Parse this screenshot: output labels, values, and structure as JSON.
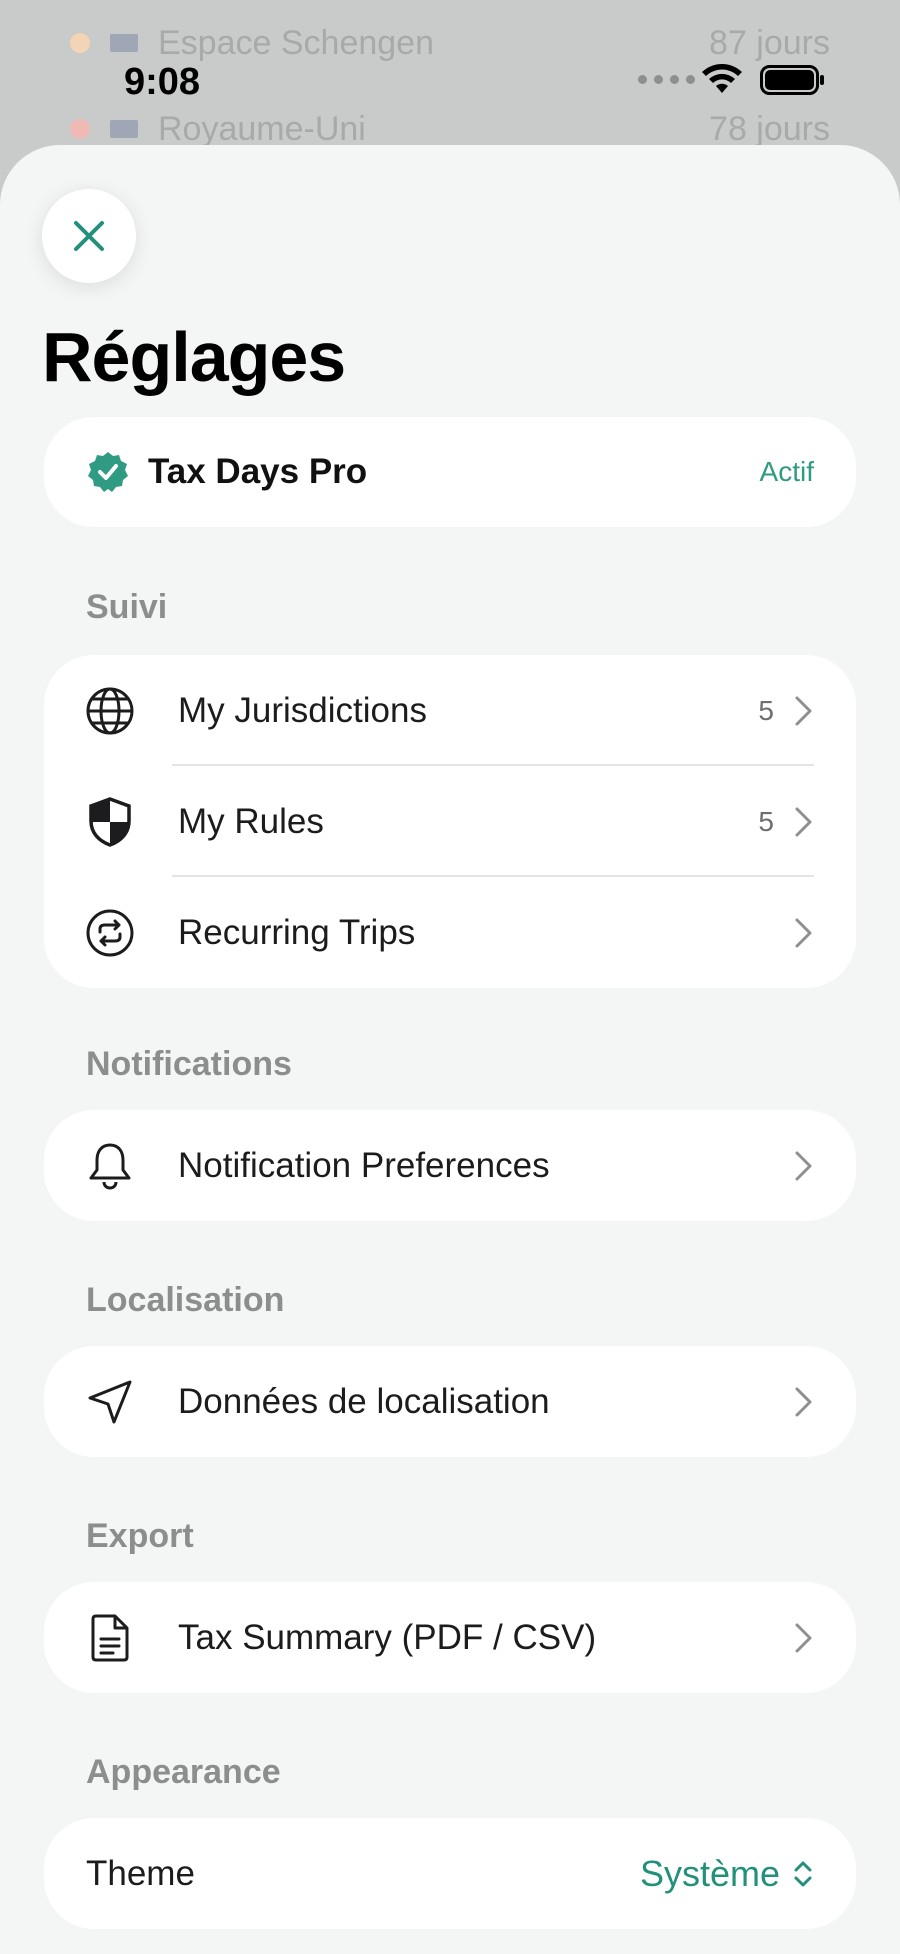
{
  "background": {
    "rows": [
      {
        "label": "Espace Schengen",
        "trail": "87 jours",
        "dot_color": "#f3d4b4"
      },
      {
        "label": "Royaume-Uni",
        "trail": "78 jours",
        "dot_color": "#f0b9b5"
      }
    ]
  },
  "status_bar": {
    "time": "9:08"
  },
  "sheet": {
    "title": "Réglages",
    "subscription": {
      "name": "Tax Days Pro",
      "status": "Actif"
    },
    "sections": {
      "suivi": {
        "header": "Suivi",
        "items": [
          {
            "label": "My Jurisdictions",
            "count": "5"
          },
          {
            "label": "My Rules",
            "count": "5"
          },
          {
            "label": "Recurring Trips",
            "count": ""
          }
        ]
      },
      "notifications": {
        "header": "Notifications",
        "items": [
          {
            "label": "Notification Preferences"
          }
        ]
      },
      "localisation": {
        "header": "Localisation",
        "items": [
          {
            "label": "Données de localisation"
          }
        ]
      },
      "export": {
        "header": "Export",
        "items": [
          {
            "label": "Tax Summary (PDF / CSV)"
          }
        ]
      },
      "appearance": {
        "header": "Appearance",
        "theme_label": "Theme",
        "theme_value": "Système"
      }
    }
  },
  "colors": {
    "accent": "#2f9b82",
    "sheet_bg": "#f4f6f5",
    "card_bg": "#ffffff"
  },
  "icons": [
    "close-icon",
    "verified-badge-icon",
    "globe-icon",
    "shield-icon",
    "repeat-icon",
    "bell-icon",
    "location-arrow-icon",
    "document-icon",
    "chevron-right-icon",
    "updown-chevron-icon"
  ]
}
